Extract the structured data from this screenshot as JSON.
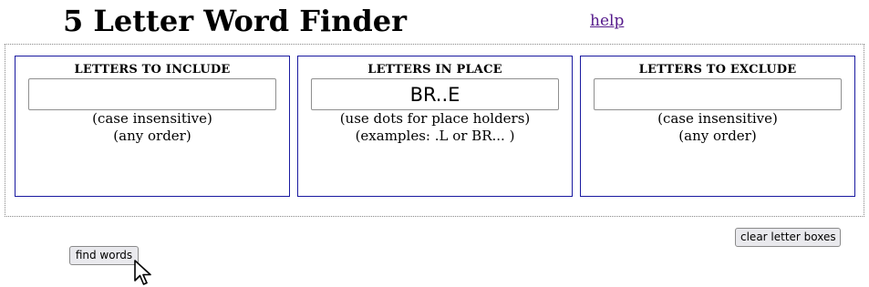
{
  "header": {
    "title": "5 Letter Word Finder",
    "help_label": "help"
  },
  "panels": {
    "include": {
      "title": "LETTERS TO INCLUDE",
      "value": "",
      "note_line1": "(case insensitive)",
      "note_line2": "(any order)"
    },
    "place": {
      "title": "LETTERS IN PLACE",
      "value": "BR..E",
      "note_line1": "(use dots for place holders)",
      "note_line2": "(examples: .L or BR... )"
    },
    "exclude": {
      "title": "LETTERS TO EXCLUDE",
      "value": "",
      "note_line1": "(case insensitive)",
      "note_line2": "(any order)"
    }
  },
  "buttons": {
    "clear_label": "clear letter boxes",
    "find_label": "find words"
  },
  "colors": {
    "panel_border": "#1a1aa0",
    "link": "#551a8b",
    "button_bg": "#e9e9ed"
  },
  "cursor": {
    "icon": "mouse-pointer-icon"
  }
}
